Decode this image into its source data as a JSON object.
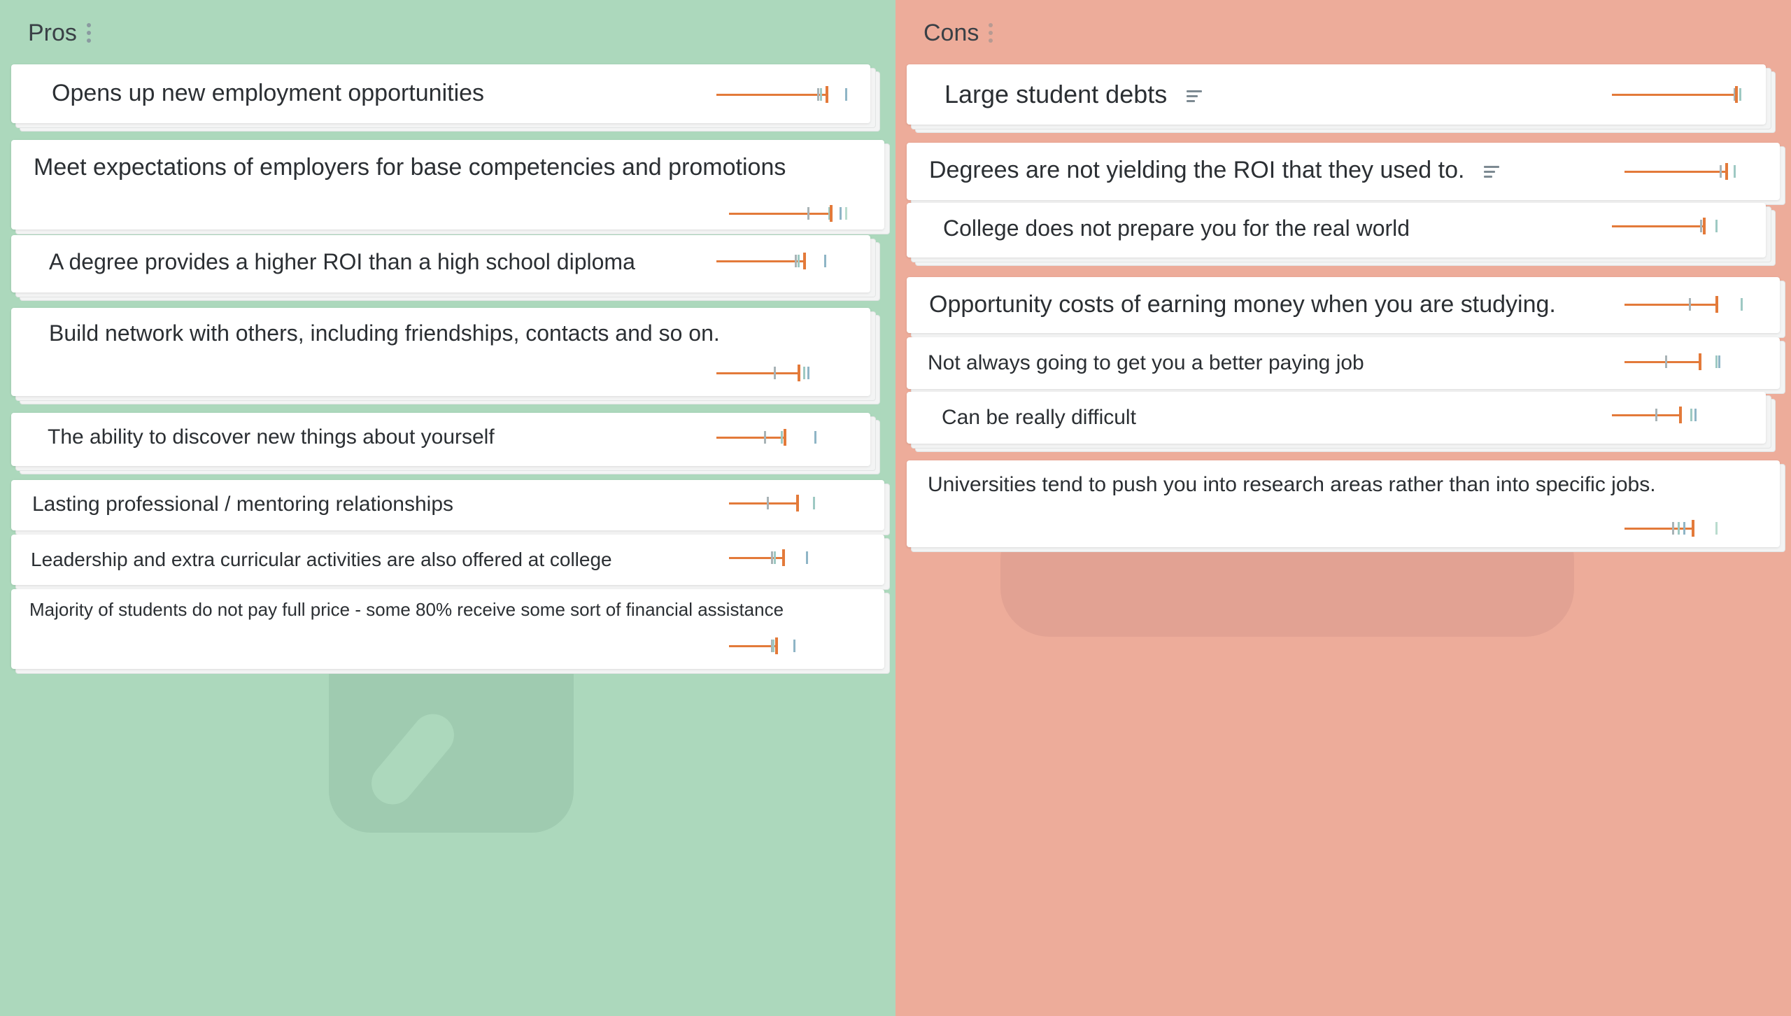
{
  "columns": [
    {
      "title": "Pros",
      "cards": [
        {
          "text": "Opens up new employment opportunities",
          "meter": {
            "value": 0.79,
            "ticks": [
              0.72,
              0.74,
              0.92
            ]
          }
        },
        {
          "text": "Meet expectations of employers for base competencies and promotions",
          "meter": {
            "value": 0.73,
            "ticks": [
              0.56,
              0.71,
              0.79,
              0.83
            ]
          }
        },
        {
          "text": "A degree provides a higher ROI than a high school diploma",
          "meter": {
            "value": 0.63,
            "ticks": [
              0.56,
              0.58,
              0.77
            ]
          }
        },
        {
          "text": "Build network with others, including friendships, contacts and so on.",
          "meter": {
            "value": 0.59,
            "ticks": [
              0.41,
              0.62,
              0.65
            ]
          }
        },
        {
          "text": "The ability to discover new things about yourself",
          "meter": {
            "value": 0.49,
            "ticks": [
              0.34,
              0.46,
              0.7
            ]
          }
        },
        {
          "text": "Lasting professional / mentoring relationships",
          "meter": {
            "value": 0.49,
            "ticks": [
              0.27,
              0.6
            ]
          }
        },
        {
          "text": "Leadership and extra curricular activities are also offered at college",
          "meter": {
            "value": 0.39,
            "ticks": [
              0.3,
              0.32,
              0.55
            ]
          }
        },
        {
          "text": "Majority of students do not pay full price - some 80% receive some sort of financial assistance",
          "meter": {
            "value": 0.34,
            "ticks": [
              0.3,
              0.31,
              0.46
            ]
          }
        }
      ]
    },
    {
      "title": "Cons",
      "cards": [
        {
          "text": "Large student debts",
          "meter": {
            "value": 0.89,
            "ticks": [
              0.87,
              0.91
            ]
          }
        },
        {
          "text": "Degrees are not yielding the ROI that they used to.",
          "meter": {
            "value": 0.73,
            "ticks": [
              0.68,
              0.78
            ]
          }
        },
        {
          "text": "College does not prepare you for the real world",
          "meter": {
            "value": 0.66,
            "ticks": [
              0.63,
              0.74
            ]
          }
        },
        {
          "text": "Opportunity costs of earning money when you are studying.",
          "meter": {
            "value": 0.66,
            "ticks": [
              0.46,
              0.83
            ]
          }
        },
        {
          "text": "Not always going to get you a better paying job",
          "meter": {
            "value": 0.54,
            "ticks": [
              0.29,
              0.65,
              0.67
            ]
          }
        },
        {
          "text": "Can be really difficult",
          "meter": {
            "value": 0.49,
            "ticks": [
              0.31,
              0.56,
              0.59
            ]
          }
        },
        {
          "text": "Universities tend to push you into research areas rather than into specific jobs.",
          "meter": {
            "value": 0.49,
            "ticks": [
              0.34,
              0.38,
              0.42,
              0.65
            ]
          }
        }
      ]
    }
  ]
}
